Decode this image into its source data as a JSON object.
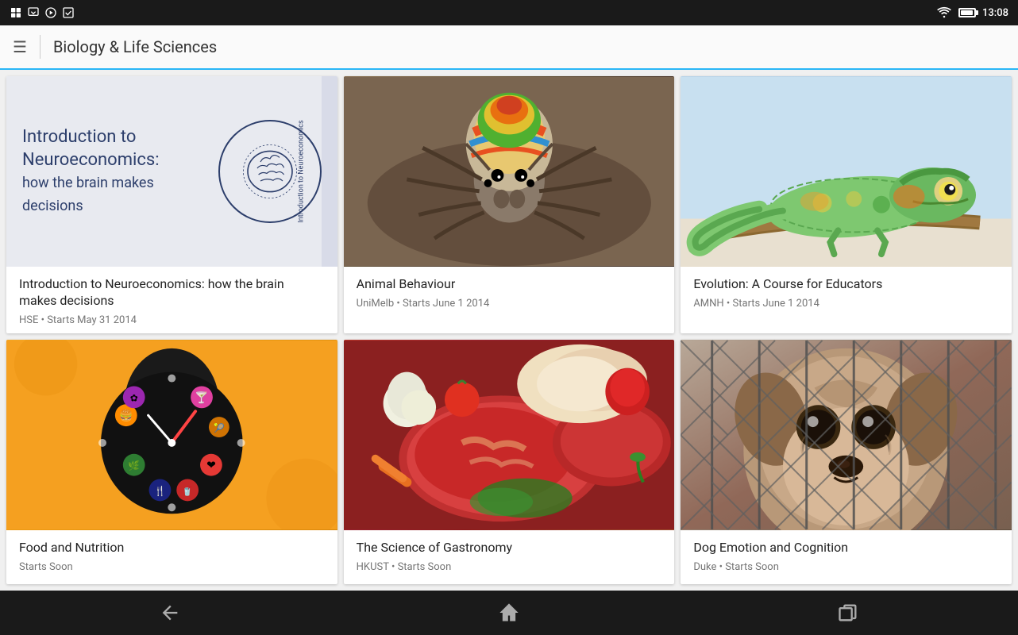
{
  "app": {
    "title": "Biology & Life Sciences",
    "status_time": "13:08"
  },
  "status_bar": {
    "icons": [
      "notification-icon",
      "download-icon",
      "play-icon",
      "check-icon"
    ],
    "time": "13:08"
  },
  "nav": {
    "menu_icon": "☰",
    "title": "Biology & Life Sciences"
  },
  "cards": [
    {
      "id": "card-1",
      "title": "Introduction to Neuroeconomics: how the brain makes decisions",
      "meta": "HSE • Starts May 31 2014",
      "image_type": "neuroeconomics",
      "image_alt": "Introduction to Neuroeconomics course cover"
    },
    {
      "id": "card-2",
      "title": "Animal Behaviour",
      "meta": "UniMelb • Starts June 1 2014",
      "image_type": "spider",
      "image_alt": "Colorful jumping spider close-up"
    },
    {
      "id": "card-3",
      "title": "Evolution: A Course for Educators",
      "meta": "AMNH • Starts June 1 2014",
      "image_type": "chameleon",
      "image_alt": "Colorful chameleon on branch"
    },
    {
      "id": "card-4",
      "title": "Food and Nutrition",
      "meta": "Starts Soon",
      "image_type": "food-clock",
      "image_alt": "Food clock on orange background"
    },
    {
      "id": "card-5",
      "title": "The Science of Gastronomy",
      "meta": "HKUST • Starts Soon",
      "image_type": "meat",
      "image_alt": "Raw meat and vegetables"
    },
    {
      "id": "card-6",
      "title": "Dog Emotion and Cognition",
      "meta": "Duke • Starts Soon",
      "image_type": "dog",
      "image_alt": "Dog behind fence"
    }
  ],
  "bottom_nav": {
    "back_label": "←",
    "home_label": "⌂",
    "recent_label": "▣"
  },
  "colors": {
    "accent": "#29b6f6",
    "status_bar": "#1a1a1a",
    "nav_bg": "#fafafa",
    "card_bg": "#ffffff",
    "title_color": "#212121",
    "meta_color": "#757575"
  }
}
